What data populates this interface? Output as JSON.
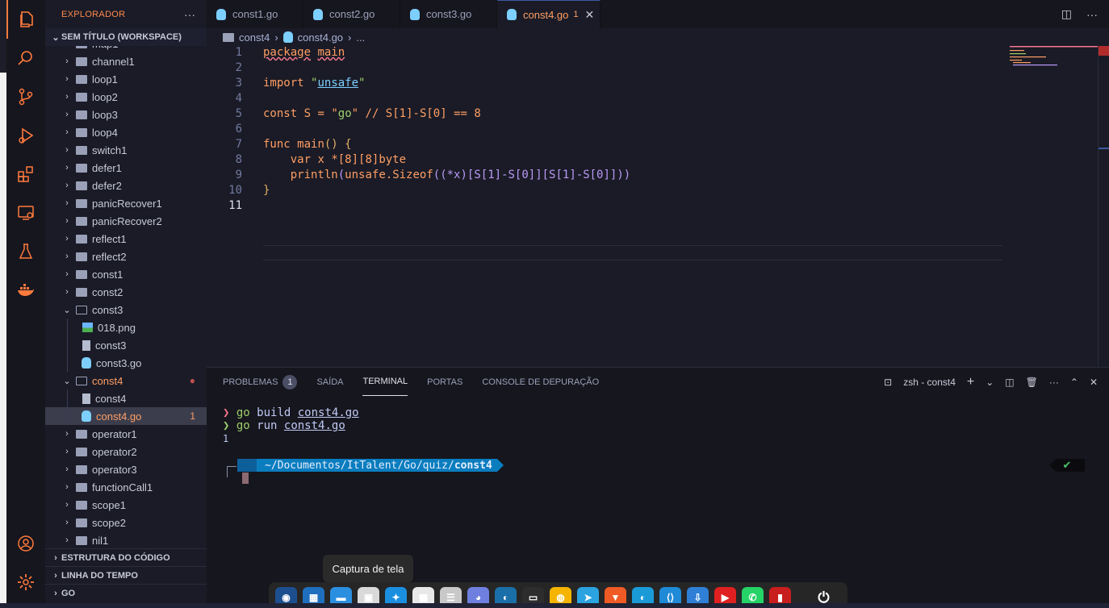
{
  "explorer": {
    "title": "EXPLORADOR",
    "more": "···",
    "workspace": "SEM TÍTULO (WORKSPACE)",
    "partial_top": "map1",
    "items": [
      {
        "label": "channel1",
        "type": "folder"
      },
      {
        "label": "loop1",
        "type": "folder"
      },
      {
        "label": "loop2",
        "type": "folder"
      },
      {
        "label": "loop3",
        "type": "folder"
      },
      {
        "label": "loop4",
        "type": "folder"
      },
      {
        "label": "switch1",
        "type": "folder"
      },
      {
        "label": "defer1",
        "type": "folder"
      },
      {
        "label": "defer2",
        "type": "folder"
      },
      {
        "label": "panicRecover1",
        "type": "folder"
      },
      {
        "label": "panicRecover2",
        "type": "folder"
      },
      {
        "label": "reflect1",
        "type": "folder"
      },
      {
        "label": "reflect2",
        "type": "folder"
      },
      {
        "label": "const1",
        "type": "folder"
      },
      {
        "label": "const2",
        "type": "folder"
      },
      {
        "label": "const3",
        "type": "folder-open"
      },
      {
        "label": "018.png",
        "type": "image"
      },
      {
        "label": "const3",
        "type": "file"
      },
      {
        "label": "const3.go",
        "type": "go"
      },
      {
        "label": "const4",
        "type": "folder-open"
      },
      {
        "label": "const4",
        "type": "file"
      },
      {
        "label": "const4.go",
        "type": "go",
        "badge": "1"
      },
      {
        "label": "operator1",
        "type": "folder"
      },
      {
        "label": "operator2",
        "type": "folder"
      },
      {
        "label": "operator3",
        "type": "folder"
      },
      {
        "label": "functionCall1",
        "type": "folder"
      },
      {
        "label": "scope1",
        "type": "folder"
      },
      {
        "label": "scope2",
        "type": "folder"
      },
      {
        "label": "nil1",
        "type": "folder"
      }
    ],
    "sections": [
      "ESTRUTURA DO CÓDIGO",
      "LINHA DO TEMPO",
      "GO"
    ]
  },
  "tabs": [
    {
      "label": "const1.go"
    },
    {
      "label": "const2.go"
    },
    {
      "label": "const3.go"
    },
    {
      "label": "const4.go",
      "badge": "1",
      "active": true
    }
  ],
  "breadcrumb": {
    "folder": "const4",
    "file": "const4.go",
    "more": "..."
  },
  "code": {
    "line_numbers": [
      "1",
      "2",
      "3",
      "4",
      "5",
      "6",
      "7",
      "8",
      "9",
      "10",
      "11"
    ],
    "pkg_kw": "package",
    "pkg_name": "main",
    "import_kw": "import",
    "import_path": "unsafe",
    "const_kw": "const",
    "const_name": "S",
    "const_val": "go",
    "const_comment": "// S[1]-S[0] == 8",
    "func_kw": "func",
    "func_name": "main",
    "var_kw": "var",
    "var_name": "x",
    "var_type": "*[8][8]byte",
    "call_fn": "println",
    "call_pkg": "unsafe",
    "call_method": "Sizeof",
    "call_arg": "((*x)[S[1]-S[0]][S[1]-S[0]]))",
    "close_brace": "}"
  },
  "panel": {
    "tabs": [
      "PROBLEMAS",
      "SAÍDA",
      "TERMINAL",
      "PORTAS",
      "CONSOLE DE DEPURAÇÃO"
    ],
    "problems_count": "1",
    "active_tab": "TERMINAL",
    "terminal_name": "zsh - const4",
    "lines": [
      {
        "prompt": "❯",
        "cmd": "go",
        "rest": " build ",
        "arg": "const4.go"
      },
      {
        "prompt": "❯",
        "cmd": "go",
        "rest": " run ",
        "arg": "const4.go"
      }
    ],
    "output": "1",
    "pl_home": "",
    "pl_path": " ~/Documentos/ItTalent/Go/quiz/",
    "pl_dir": "const4",
    "status_ok": "✔"
  },
  "tooltip": "Captura de tela",
  "dock": {
    "apps": [
      {
        "name": "app-launcher",
        "color": "#1d4f8f",
        "glyph": "◉"
      },
      {
        "name": "files",
        "color": "#1f6fbf",
        "glyph": "▦"
      },
      {
        "name": "file-manager",
        "color": "#2b8fe0",
        "glyph": "▬"
      },
      {
        "name": "screenshot",
        "color": "#d9d9d9",
        "glyph": "▣"
      },
      {
        "name": "browser-blue",
        "color": "#1a8fe0",
        "glyph": "✦"
      },
      {
        "name": "calculator",
        "color": "#e8e8e8",
        "glyph": "▦"
      },
      {
        "name": "system",
        "color": "#c8c8c8",
        "glyph": "☰"
      },
      {
        "name": "discord",
        "color": "#6f7fe0",
        "glyph": "◕"
      },
      {
        "name": "tool",
        "color": "#1b6fa8",
        "glyph": "◐"
      },
      {
        "name": "terminal",
        "color": "#2d2d2d",
        "glyph": "▭"
      },
      {
        "name": "chrome",
        "color": "#f4b400",
        "glyph": "◍"
      },
      {
        "name": "telegram",
        "color": "#2aa3e0",
        "glyph": "➤"
      },
      {
        "name": "brave",
        "color": "#f05a24",
        "glyph": "▼"
      },
      {
        "name": "edge",
        "color": "#1a9bd8",
        "glyph": "◐"
      },
      {
        "name": "vscode",
        "color": "#1f8ad6",
        "glyph": "⟨⟩"
      },
      {
        "name": "downloader",
        "color": "#2f7fd6",
        "glyph": "⇩"
      },
      {
        "name": "youtube",
        "color": "#e02020",
        "glyph": "▶"
      },
      {
        "name": "whatsapp",
        "color": "#25d366",
        "glyph": "✆"
      },
      {
        "name": "red-app",
        "color": "#c81e1e",
        "glyph": "▮"
      },
      {
        "name": "power",
        "color": "#262626",
        "glyph": "⏻"
      }
    ]
  },
  "colors": {
    "accent": "#ff7a3d",
    "bg": "#1a1b26",
    "panel": "#16161e"
  }
}
